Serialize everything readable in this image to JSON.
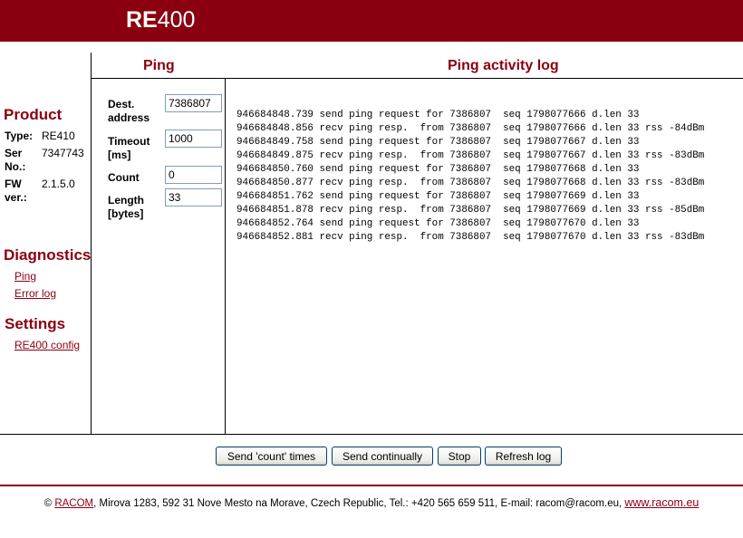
{
  "header": {
    "logo_bold": "RE",
    "logo_rest": "400"
  },
  "ping_panel": {
    "title": "Ping",
    "fields": [
      {
        "label_line1": "Dest.",
        "label_line2": "address",
        "value": "7386807"
      },
      {
        "label_line1": "Timeout",
        "label_line2": "[ms]",
        "value": "1000"
      },
      {
        "label_line1": "Count",
        "label_line2": "",
        "value": "0"
      },
      {
        "label_line1": "Length",
        "label_line2": "[bytes]",
        "value": "33"
      }
    ]
  },
  "log_panel": {
    "title": "Ping activity log",
    "lines": [
      "946684848.739 send ping request for 7386807  seq 1798077666 d.len 33",
      "946684848.856 recv ping resp.  from 7386807  seq 1798077666 d.len 33 rss -84dBm",
      "946684849.758 send ping request for 7386807  seq 1798077667 d.len 33",
      "946684849.875 recv ping resp.  from 7386807  seq 1798077667 d.len 33 rss -83dBm",
      "946684850.760 send ping request for 7386807  seq 1798077668 d.len 33",
      "946684850.877 recv ping resp.  from 7386807  seq 1798077668 d.len 33 rss -83dBm",
      "946684851.762 send ping request for 7386807  seq 1798077669 d.len 33",
      "946684851.878 recv ping resp.  from 7386807  seq 1798077669 d.len 33 rss -85dBm",
      "946684852.764 send ping request for 7386807  seq 1798077670 d.len 33",
      "946684852.881 recv ping resp.  from 7386807  seq 1798077670 d.len 33 rss -83dBm"
    ]
  },
  "sidebar": {
    "product": {
      "heading": "Product",
      "type_label": "Type:",
      "type_value": "RE410",
      "ser_label_1": "Ser",
      "ser_label_2": "No.:",
      "ser_value": "7347743",
      "fw_label_1": "FW",
      "fw_label_2": "ver.:",
      "fw_value": "2.1.5.0"
    },
    "diagnostics": {
      "heading": "Diagnostics",
      "links": [
        "Ping",
        "Error log"
      ]
    },
    "settings": {
      "heading": "Settings",
      "links": [
        "RE400 config"
      ]
    }
  },
  "buttons": {
    "send_count": "Send 'count' times",
    "send_continually": "Send continually",
    "stop": "Stop",
    "refresh": "Refresh log"
  },
  "footer": {
    "copyright": "©",
    "company_link": "RACOM",
    "address": ", Mirova 1283, 592 31 Nove Mesto na Morave, Czech Republic, Tel.: +420 565 659 511, E-mail: racom@racom.eu, ",
    "website_link": "www.racom.eu"
  },
  "colors": {
    "brand": "#8b0010",
    "input_border": "#7f9db9",
    "button_border": "#003c74"
  }
}
